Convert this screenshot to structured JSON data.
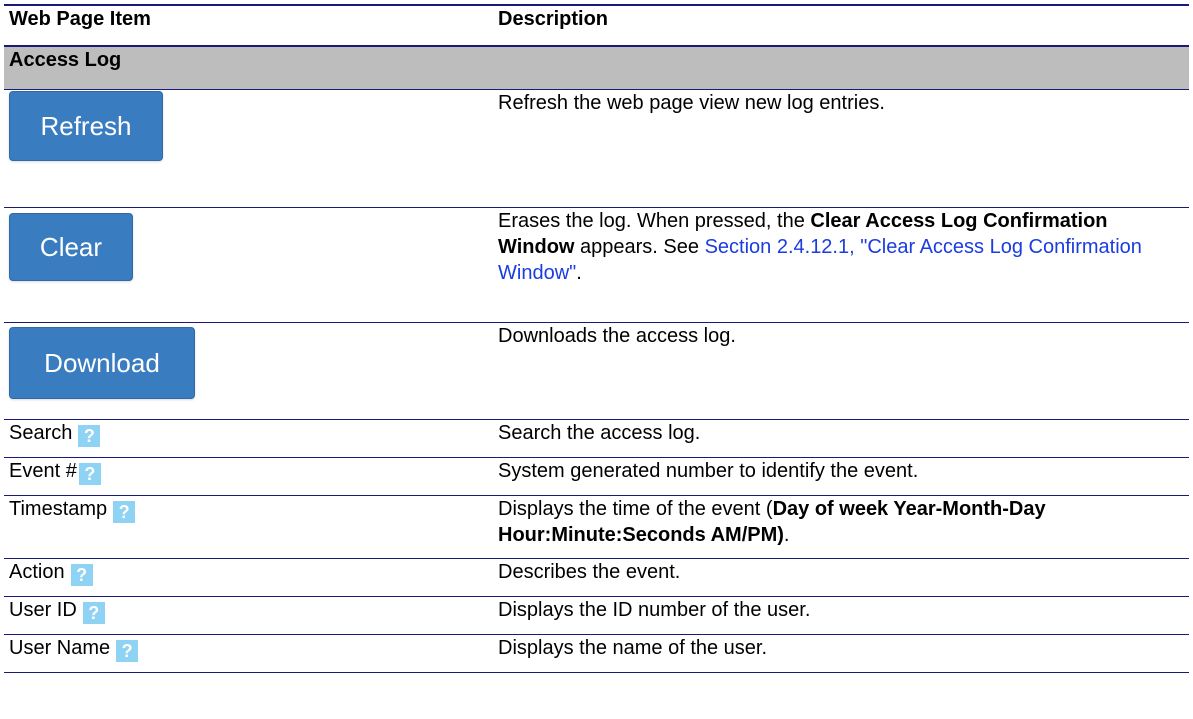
{
  "header": {
    "col1": "Web Page Item",
    "col2": "Description"
  },
  "section": {
    "title": "Access Log"
  },
  "buttons": {
    "refresh": {
      "label": "Refresh",
      "description": "Refresh the web page view new log entries."
    },
    "clear": {
      "label": "Clear",
      "desc_part1": "Erases the log. When pressed, the ",
      "desc_bold": "Clear Access Log Confirmation Window",
      "desc_part2": " appears. See ",
      "desc_link": "Section 2.4.12.1, \"Clear Access Log Confirmation Window\"",
      "desc_end": "."
    },
    "download": {
      "label": "Download",
      "description": "Downloads the access log."
    }
  },
  "fields": [
    {
      "name": "Search",
      "description": "Search the access log."
    },
    {
      "name": "Event #",
      "description": "System generated number to identify the event."
    },
    {
      "name": "Timestamp",
      "desc_part1": "Displays the time of the event (",
      "desc_bold": "Day of week Year-Month-Day Hour:Minute:Seconds AM/PM)",
      "desc_end": "."
    },
    {
      "name": "Action",
      "description": "Describes the event."
    },
    {
      "name": "User ID",
      "description": "Displays the ID number of the user."
    },
    {
      "name": "User Name",
      "description": "Displays the name of the user."
    }
  ],
  "help_icon": {
    "glyph": "?",
    "icon": "question-mark-icon",
    "color": "#8fd3f4"
  },
  "colors": {
    "button": "#3a7cc0",
    "section_bg": "#bdbdbd",
    "rule": "#1a1a7a",
    "link": "#1a3ce0"
  }
}
